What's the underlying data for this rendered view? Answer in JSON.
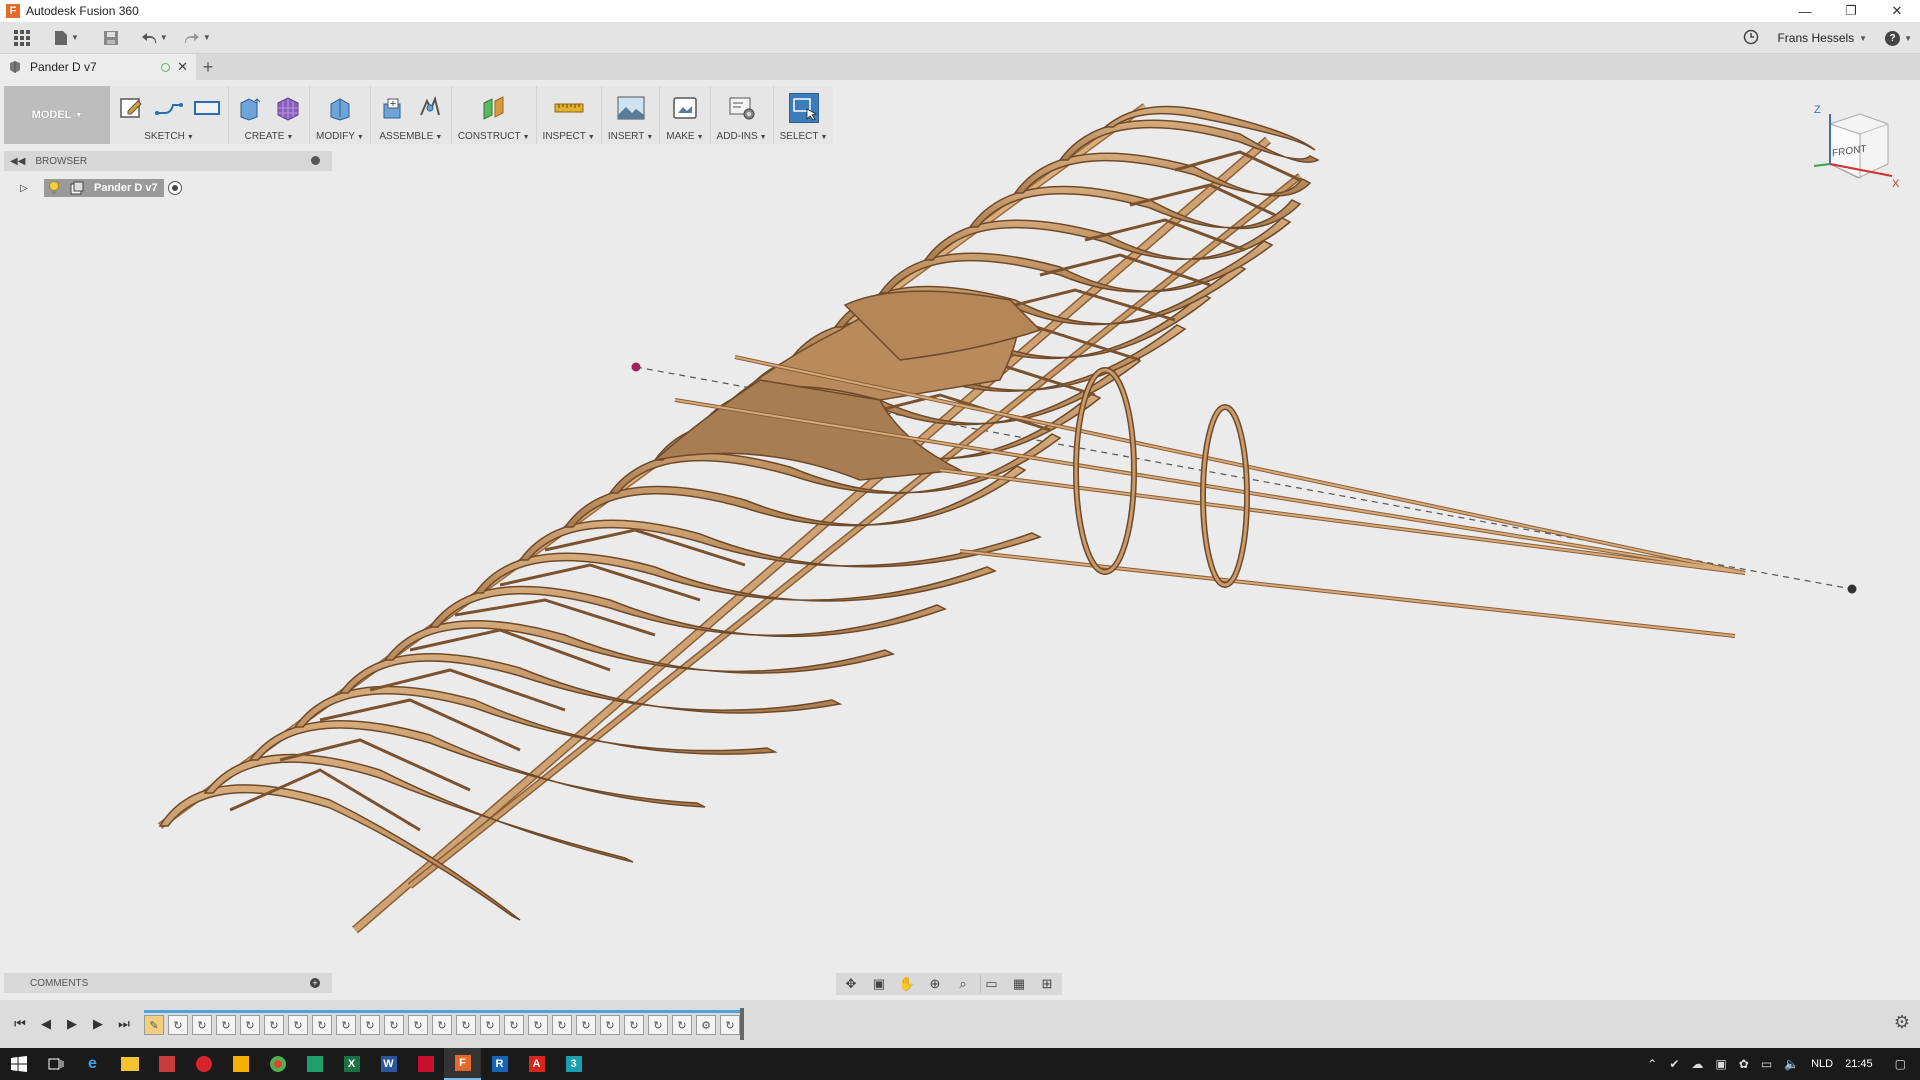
{
  "window": {
    "app_title": "Autodesk Fusion 360",
    "controls": [
      "—",
      "❐",
      "✕"
    ]
  },
  "qat": {
    "user_name": "Frans Hessels",
    "help_label": "?"
  },
  "tabs": {
    "document_tab": "Pander D v7",
    "new_tab": "+"
  },
  "toolbar": {
    "workspace": "MODEL",
    "groups": {
      "sketch": "SKETCH",
      "create": "CREATE",
      "modify": "MODIFY",
      "assemble": "ASSEMBLE",
      "construct": "CONSTRUCT",
      "inspect": "INSPECT",
      "insert": "INSERT",
      "make": "MAKE",
      "addins": "ADD-INS",
      "select": "SELECT"
    }
  },
  "browser": {
    "title": "BROWSER",
    "root_node": "Pander D v7"
  },
  "comments": {
    "title": "COMMENTS"
  },
  "viewcube": {
    "face": "FRONT",
    "axis_z": "Z",
    "axis_x": "X"
  },
  "taskbar": {
    "language": "NLD",
    "time": "21:45"
  },
  "colors": {
    "wood": "#c89a6a",
    "wood_dark": "#8a6038",
    "select_active": "#3d7cb8",
    "timeline_bar": "#4aa3df"
  }
}
